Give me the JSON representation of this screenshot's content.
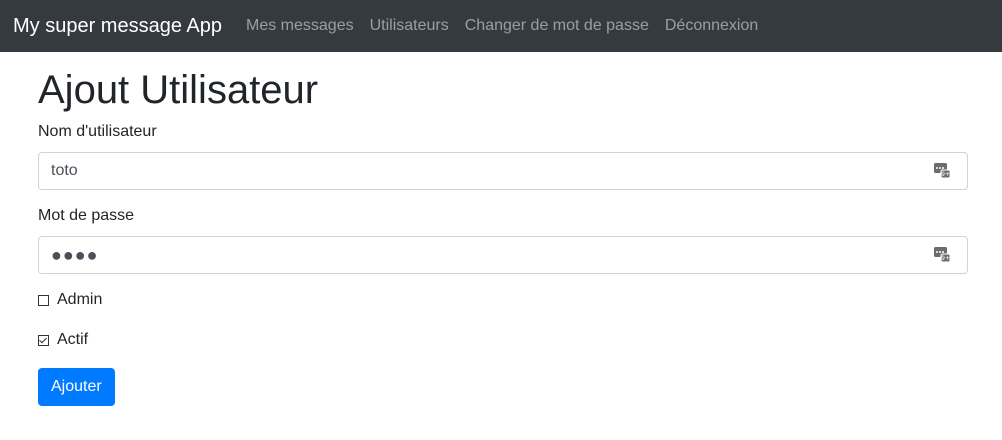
{
  "navbar": {
    "brand": "My super message App",
    "links": [
      "Mes messages",
      "Utilisateurs",
      "Changer de mot de passe",
      "Déconnexion"
    ],
    "background": "#343a40"
  },
  "page": {
    "title": "Ajout Utilisateur"
  },
  "form": {
    "username_label": "Nom d'utilisateur",
    "username_value": "toto",
    "password_label": "Mot de passe",
    "password_display": "●●●●",
    "admin_label": "Admin",
    "admin_checked": false,
    "active_label": "Actif",
    "active_checked": true,
    "submit_label": "Ajouter",
    "field_icon": "password-manager-icon"
  },
  "colors": {
    "primary": "#007bff"
  }
}
